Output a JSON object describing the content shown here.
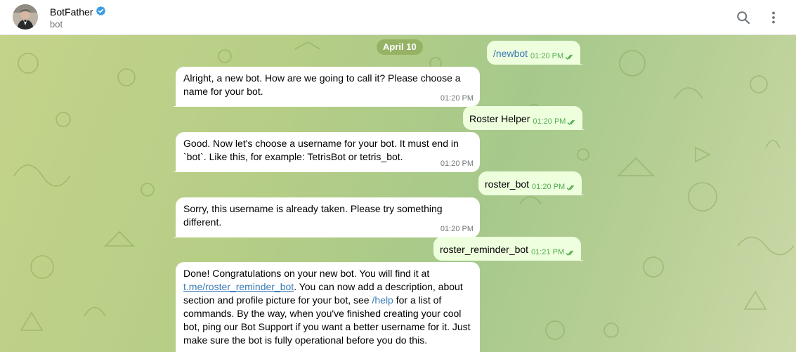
{
  "header": {
    "name": "BotFather",
    "subtitle": "bot",
    "verified_icon": "verified-badge-icon",
    "search_icon": "search-icon",
    "menu_icon": "more-vertical-icon"
  },
  "chat": {
    "date_label": "April 10",
    "messages": [
      {
        "dir": "out",
        "text": "/newbot",
        "time": "01:20 PM"
      },
      {
        "dir": "in",
        "text": "Alright, a new bot. How are we going to call it? Please choose a name for your bot.",
        "time": "01:20 PM"
      },
      {
        "dir": "out",
        "text": "Roster Helper",
        "time": "01:20 PM"
      },
      {
        "dir": "in",
        "text": "Good. Now let's choose a username for your bot. It must end in `bot`. Like this, for example: TetrisBot or tetris_bot.",
        "time": "01:20 PM"
      },
      {
        "dir": "out",
        "text": "roster_bot",
        "time": "01:20 PM"
      },
      {
        "dir": "in",
        "text": "Sorry, this username is already taken. Please try something different.",
        "time": "01:20 PM"
      },
      {
        "dir": "out",
        "text": "roster_reminder_bot",
        "time": "01:21 PM"
      },
      {
        "dir": "in",
        "part1": "Done! Congratulations on your new bot. You will find it at ",
        "link": "t.me/roster_reminder_bot",
        "part2": ". You can now add a description, about section and profile picture for your bot, see ",
        "cmd": "/help",
        "part3": " for a list of commands. By the way, when you've finished creating your cool bot, ping our Bot Support if you want a better username for it. Just make sure the bot is fully operational before you do this."
      }
    ]
  },
  "colors": {
    "incoming_bg": "#ffffff",
    "outgoing_bg": "#eeffde",
    "check_color": "#4fae4e",
    "link_color": "#3a79b6"
  }
}
